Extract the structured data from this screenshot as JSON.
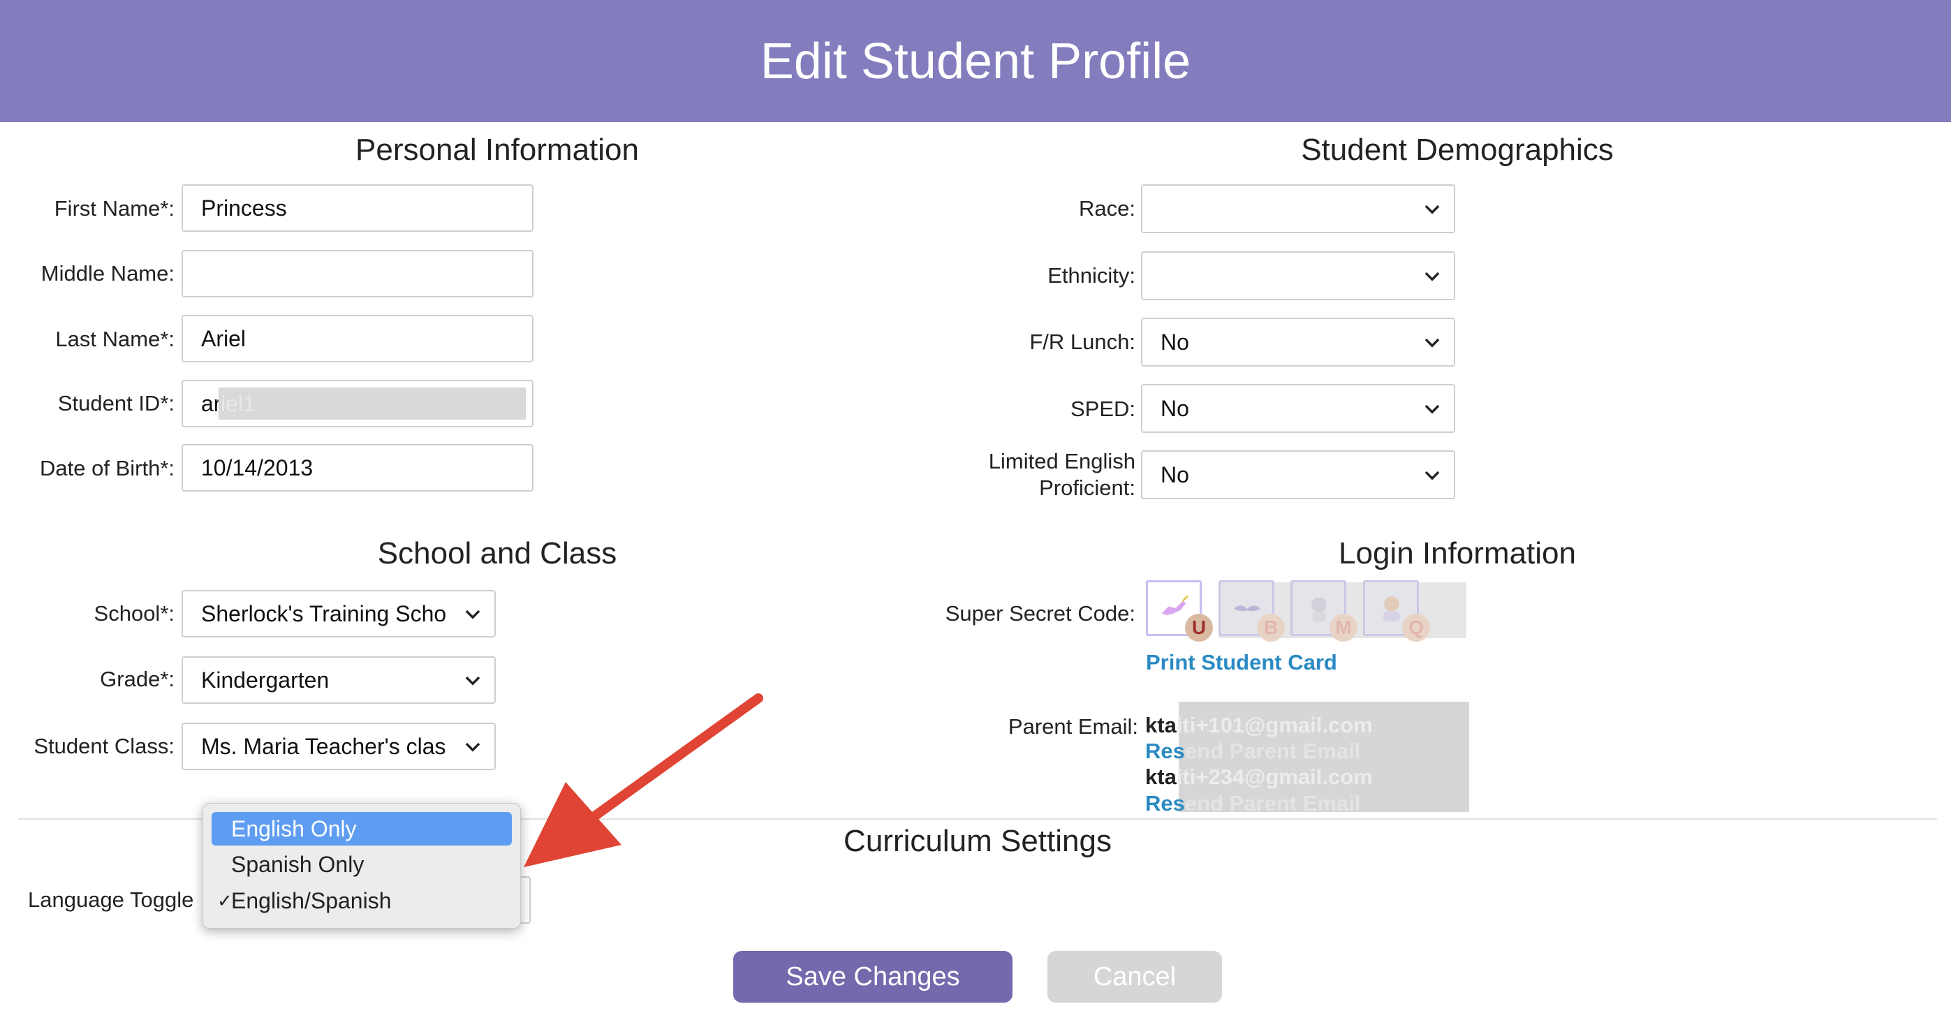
{
  "header": {
    "title": "Edit Student Profile"
  },
  "personal": {
    "title": "Personal Information",
    "first_name": {
      "label": "First Name*:",
      "value": "Princess"
    },
    "middle_name": {
      "label": "Middle Name:",
      "value": ""
    },
    "last_name": {
      "label": "Last Name*:",
      "value": "Ariel"
    },
    "student_id": {
      "label": "Student ID*:",
      "value": "ar",
      "ghost": "iel1"
    },
    "dob": {
      "label": "Date of Birth*:",
      "value": "10/14/2013"
    }
  },
  "demographics": {
    "title": "Student Demographics",
    "race": {
      "label": "Race:",
      "value": ""
    },
    "ethnicity": {
      "label": "Ethnicity:",
      "value": ""
    },
    "fr_lunch": {
      "label": "F/R Lunch:",
      "value": "No"
    },
    "sped": {
      "label": "SPED:",
      "value": "No"
    },
    "lep": {
      "label_line1": "Limited English",
      "label_line2": "Proficient:",
      "value": "No"
    }
  },
  "school": {
    "title": "School and Class",
    "school": {
      "label": "School*:",
      "value": "Sherlock's Training School"
    },
    "grade": {
      "label": "Grade*:",
      "value": "Kindergarten"
    },
    "student_class": {
      "label": "Student Class:",
      "value": "Ms. Maria Teacher's class"
    }
  },
  "login": {
    "title": "Login Information",
    "secret_code_label": "Super Secret Code:",
    "code_letters": [
      "U",
      "B",
      "M",
      "Q"
    ],
    "print_card": "Print Student Card",
    "parent_email_label": "Parent Email:",
    "emails": [
      {
        "prefix": "kta",
        "ghost": "iti+101@gmail.com",
        "resend_prefix": "Res",
        "resend_ghost": "end Parent Email"
      },
      {
        "prefix": "kta",
        "ghost": "iti+234@gmail.com",
        "resend_prefix": "Res",
        "resend_ghost": "end Parent Email"
      }
    ]
  },
  "curriculum": {
    "title": "Curriculum Settings",
    "language_label": "Language Toggle",
    "options": [
      "English Only",
      "Spanish Only",
      "English/Spanish"
    ],
    "highlighted": "English Only",
    "checkmark": "✓"
  },
  "actions": {
    "save": "Save Changes",
    "cancel": "Cancel"
  },
  "colors": {
    "header": "#837dbd",
    "save_button": "#736aad",
    "cancel_button": "#d6d6d6",
    "link": "#2b8ac4",
    "dropdown_highlight": "#5e9df1",
    "arrow": "#e04434"
  }
}
